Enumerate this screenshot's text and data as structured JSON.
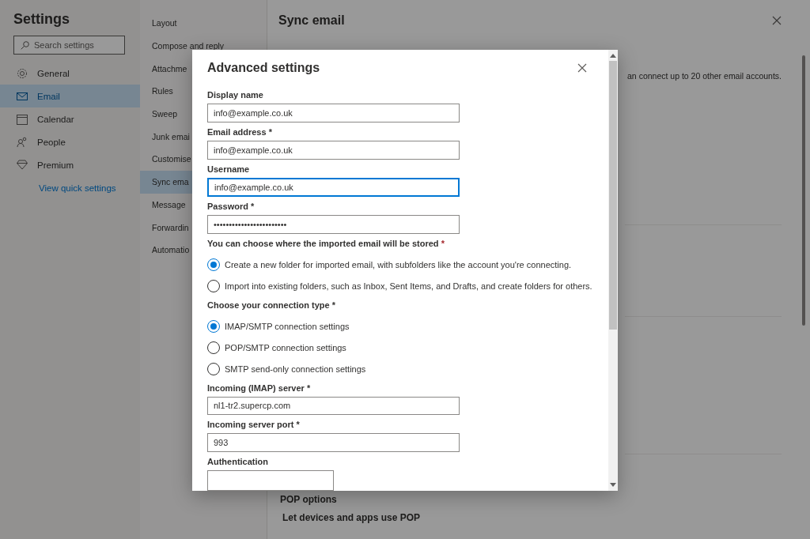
{
  "sidebar": {
    "title": "Settings",
    "search": {
      "placeholder": "Search settings"
    },
    "items": [
      {
        "label": "General",
        "selected": false
      },
      {
        "label": "Email",
        "selected": true
      },
      {
        "label": "Calendar",
        "selected": false
      },
      {
        "label": "People",
        "selected": false
      },
      {
        "label": "Premium",
        "selected": false
      }
    ],
    "link": "View quick settings"
  },
  "subnav": {
    "items": [
      {
        "label": "Layout",
        "selected": false
      },
      {
        "label": "Compose and reply",
        "selected": false
      },
      {
        "label": "Attachme",
        "selected": false
      },
      {
        "label": "Rules",
        "selected": false
      },
      {
        "label": "Sweep",
        "selected": false
      },
      {
        "label": "Junk emai",
        "selected": false
      },
      {
        "label": "Customise",
        "selected": false
      },
      {
        "label": "Sync ema",
        "selected": true
      },
      {
        "label": "Message",
        "selected": false
      },
      {
        "label": "Forwardin",
        "selected": false
      },
      {
        "label": "Automatio",
        "selected": false
      }
    ]
  },
  "pane": {
    "title": "Sync email",
    "intro": "an connect up to 20 other email accounts.",
    "sections": [
      {
        "heading": "POP options",
        "text": "Let devices and apps use POP"
      }
    ]
  },
  "dialog": {
    "title": "Advanced settings",
    "body": [
      {
        "kind": "field",
        "label": "Display name",
        "value": "info@example.co.uk",
        "focused": false
      },
      {
        "kind": "field",
        "label": "Email address *",
        "value": "info@example.co.uk",
        "focused": false
      },
      {
        "kind": "field",
        "label": "Username",
        "value": "info@example.co.uk",
        "focused": true
      },
      {
        "kind": "field",
        "label": "Password *",
        "value": "••••••••••••••••••••••••",
        "focused": false
      },
      {
        "kind": "radio_group",
        "label": "You can choose where the imported email will be stored",
        "mark": "*",
        "options": [
          {
            "label": "Create a new folder for imported email, with subfolders like the account you're connecting.",
            "selected": true
          },
          {
            "label": "Import into existing folders, such as Inbox, Sent Items, and Drafts, and create folders for others.",
            "selected": false
          }
        ]
      },
      {
        "kind": "radio_group",
        "label": "Choose your connection type *",
        "options": [
          {
            "label": "IMAP/SMTP connection settings",
            "selected": true
          },
          {
            "label": "POP/SMTP connection settings",
            "selected": false
          },
          {
            "label": "SMTP send-only connection settings",
            "selected": false
          }
        ]
      },
      {
        "kind": "field",
        "label": "Incoming (IMAP) server *",
        "value": "nl1-tr2.supercp.com",
        "focused": false
      },
      {
        "kind": "field",
        "label": "Incoming server port *",
        "value": "993",
        "focused": false
      },
      {
        "kind": "select",
        "label": "Authentication"
      }
    ]
  }
}
